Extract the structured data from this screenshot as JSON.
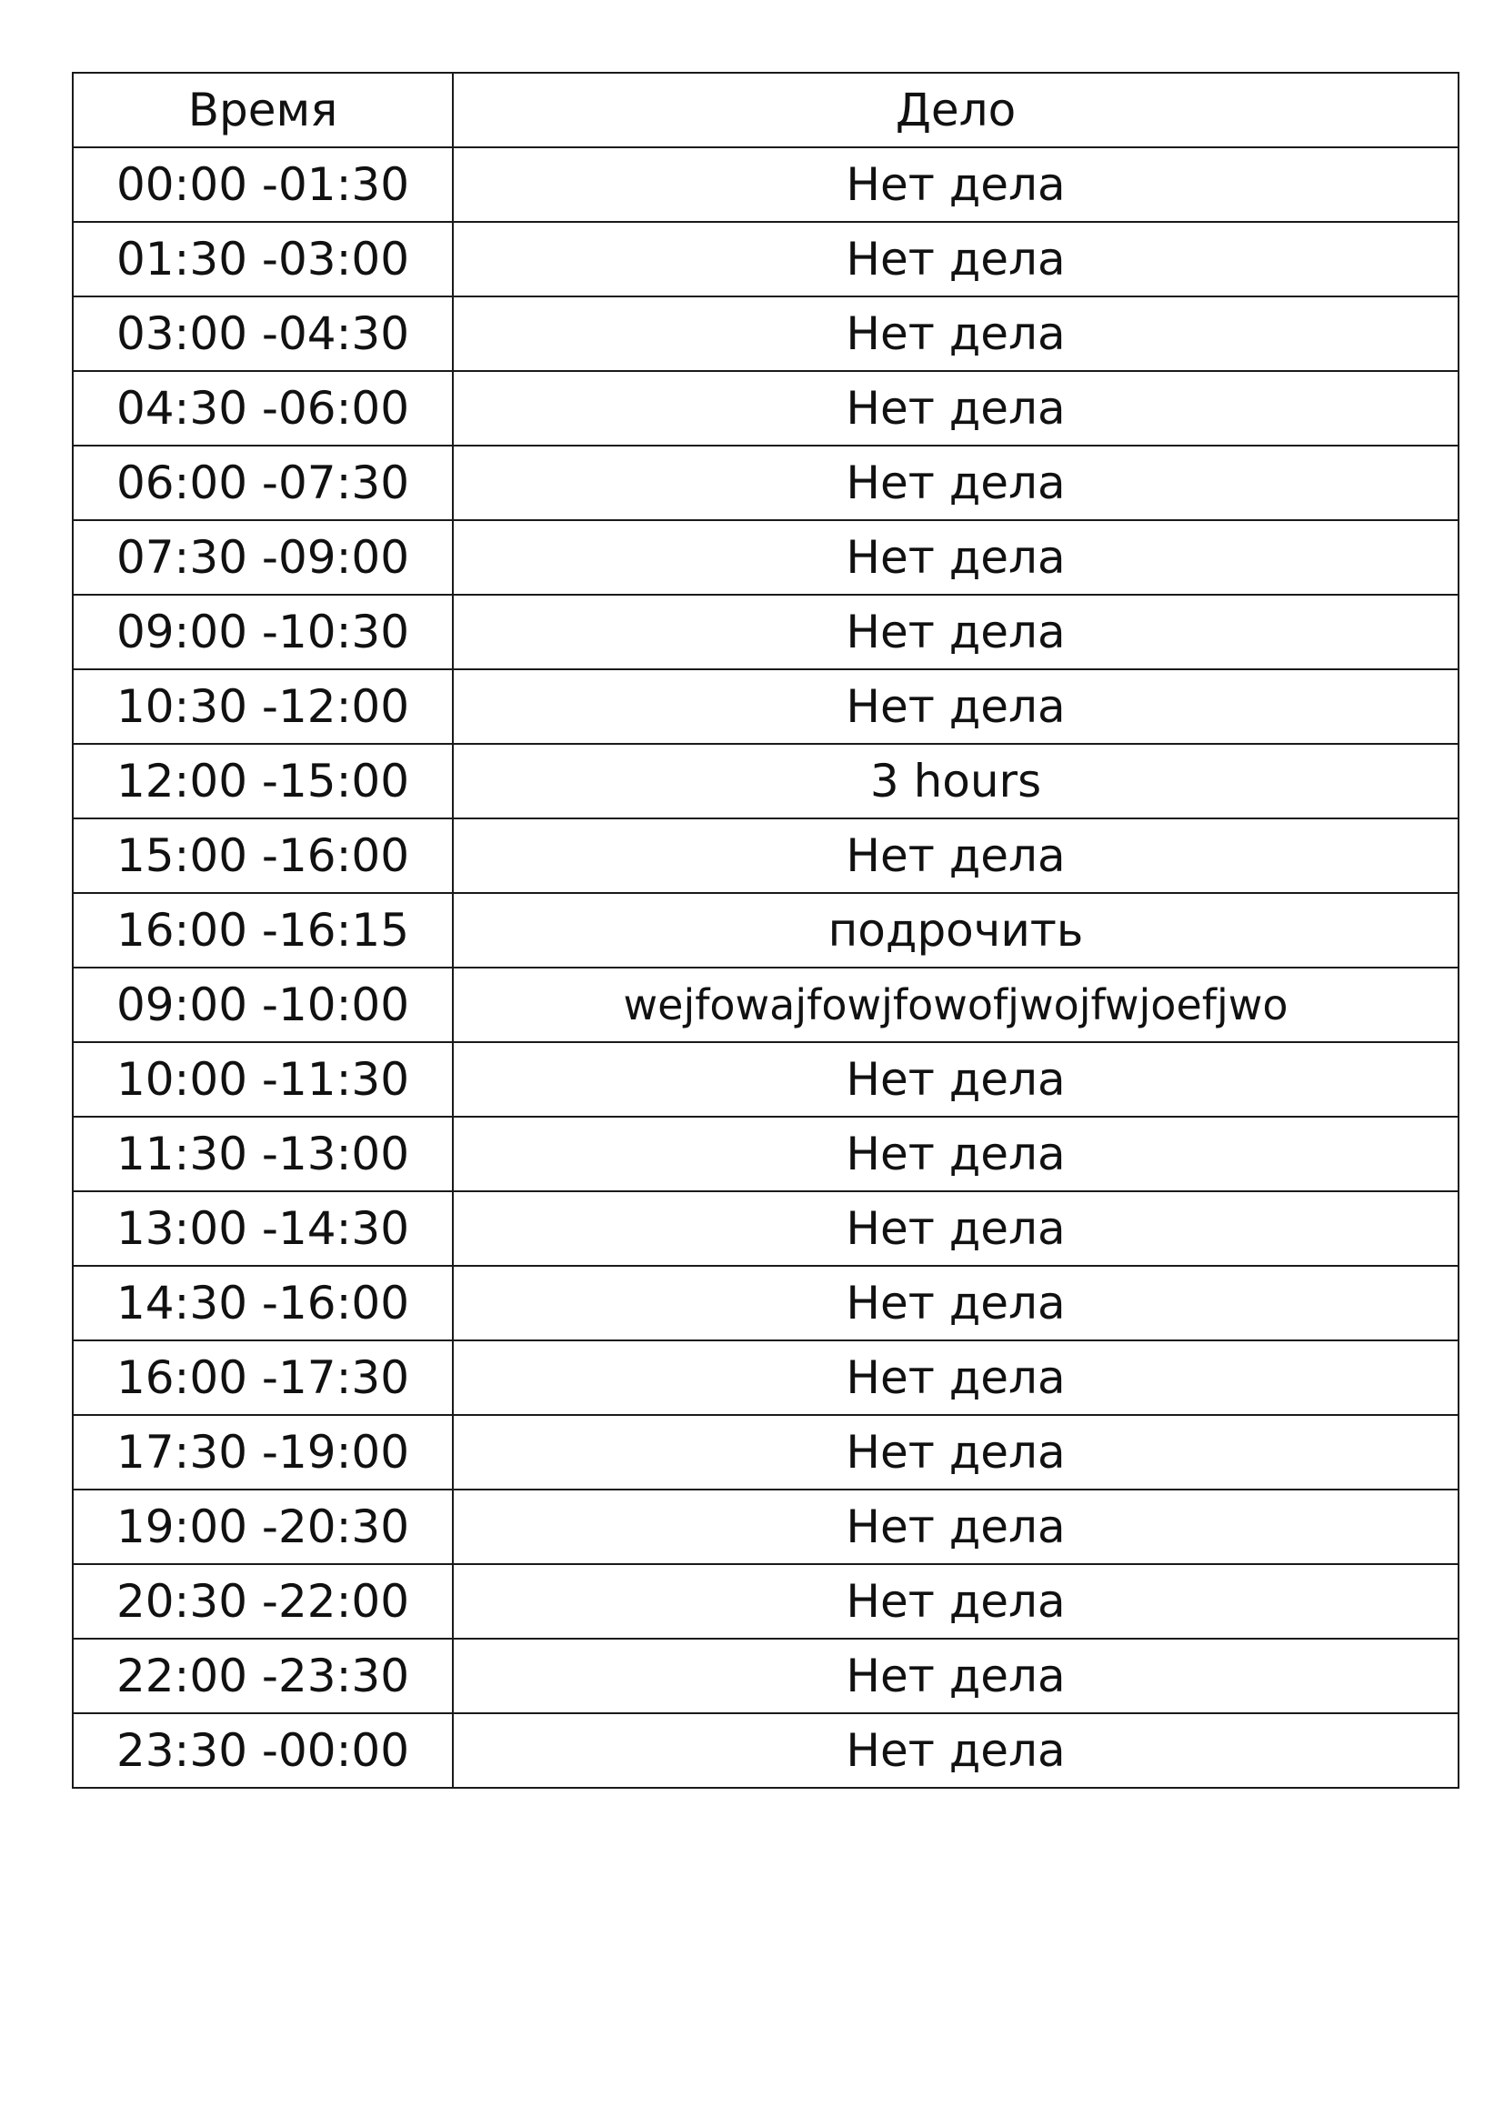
{
  "table": {
    "headers": {
      "time": "Время",
      "task": "Дело"
    },
    "rows": [
      {
        "time": "00:00 -01:30",
        "task": "Нет дела"
      },
      {
        "time": "01:30 -03:00",
        "task": "Нет дела"
      },
      {
        "time": "03:00 -04:30",
        "task": "Нет дела"
      },
      {
        "time": "04:30 -06:00",
        "task": "Нет дела"
      },
      {
        "time": "06:00 -07:30",
        "task": "Нет дела"
      },
      {
        "time": "07:30 -09:00",
        "task": "Нет дела"
      },
      {
        "time": "09:00 -10:30",
        "task": "Нет дела"
      },
      {
        "time": "10:30 -12:00",
        "task": "Нет дела"
      },
      {
        "time": "12:00 -15:00",
        "task": "3 hours"
      },
      {
        "time": "15:00 -16:00",
        "task": "Нет дела"
      },
      {
        "time": "16:00 -16:15",
        "task": "подрочить"
      },
      {
        "time": "09:00 -10:00",
        "task": "wejfowajfowjfowofjwojfwjoefjwo"
      },
      {
        "time": "10:00 -11:30",
        "task": "Нет дела"
      },
      {
        "time": "11:30 -13:00",
        "task": "Нет дела"
      },
      {
        "time": "13:00 -14:30",
        "task": "Нет дела"
      },
      {
        "time": "14:30 -16:00",
        "task": "Нет дела"
      },
      {
        "time": "16:00 -17:30",
        "task": "Нет дела"
      },
      {
        "time": "17:30 -19:00",
        "task": "Нет дела"
      },
      {
        "time": "19:00 -20:30",
        "task": "Нет дела"
      },
      {
        "time": "20:30 -22:00",
        "task": "Нет дела"
      },
      {
        "time": "22:00 -23:30",
        "task": "Нет дела"
      },
      {
        "time": "23:30 -00:00",
        "task": "Нет дела"
      }
    ]
  }
}
